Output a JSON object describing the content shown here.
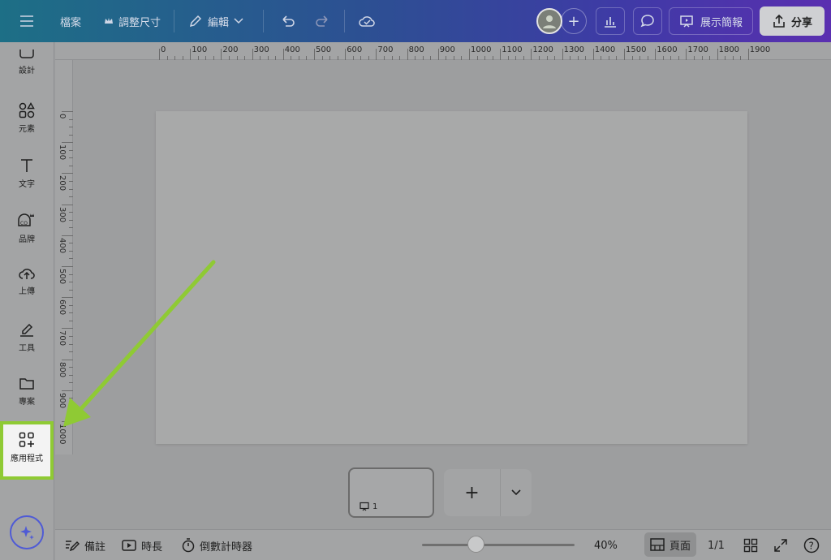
{
  "topbar": {
    "menu_icon": "hamburger-icon",
    "file_label": "檔案",
    "resize_label": "調整尺寸",
    "edit_label": "編輯",
    "present_label": "展示簡報",
    "share_label": "分享"
  },
  "sidebar": {
    "items": [
      {
        "label": "設計",
        "icon": "design-icon"
      },
      {
        "label": "元素",
        "icon": "shapes-icon"
      },
      {
        "label": "文字",
        "icon": "text-icon"
      },
      {
        "label": "品牌",
        "icon": "brand-icon"
      },
      {
        "label": "上傳",
        "icon": "cloud-upload-icon"
      },
      {
        "label": "工具",
        "icon": "pen-tool-icon"
      },
      {
        "label": "專案",
        "icon": "folder-icon"
      },
      {
        "label": "應用程式",
        "icon": "apps-icon"
      }
    ]
  },
  "ruler": {
    "top": [
      "0",
      "100",
      "200",
      "300",
      "400",
      "500",
      "600",
      "700",
      "800",
      "900",
      "1000",
      "1100",
      "1200",
      "1300",
      "1400",
      "1500",
      "1600",
      "1700",
      "1800",
      "1900"
    ],
    "left": [
      "0",
      "100",
      "200",
      "300",
      "400",
      "500",
      "600",
      "700",
      "800",
      "900",
      "1000"
    ]
  },
  "pages": {
    "thumb_number": "1"
  },
  "bottombar": {
    "notes_label": "備註",
    "duration_label": "時長",
    "timer_label": "倒數計時器",
    "zoom_value": "40%",
    "zoom_fraction": 0.35,
    "page_view_label": "頁面",
    "page_count": "1/1",
    "help_label": "?"
  },
  "colors": {
    "highlight": "#8fca34",
    "magic_ring": "#4f5bd5"
  }
}
